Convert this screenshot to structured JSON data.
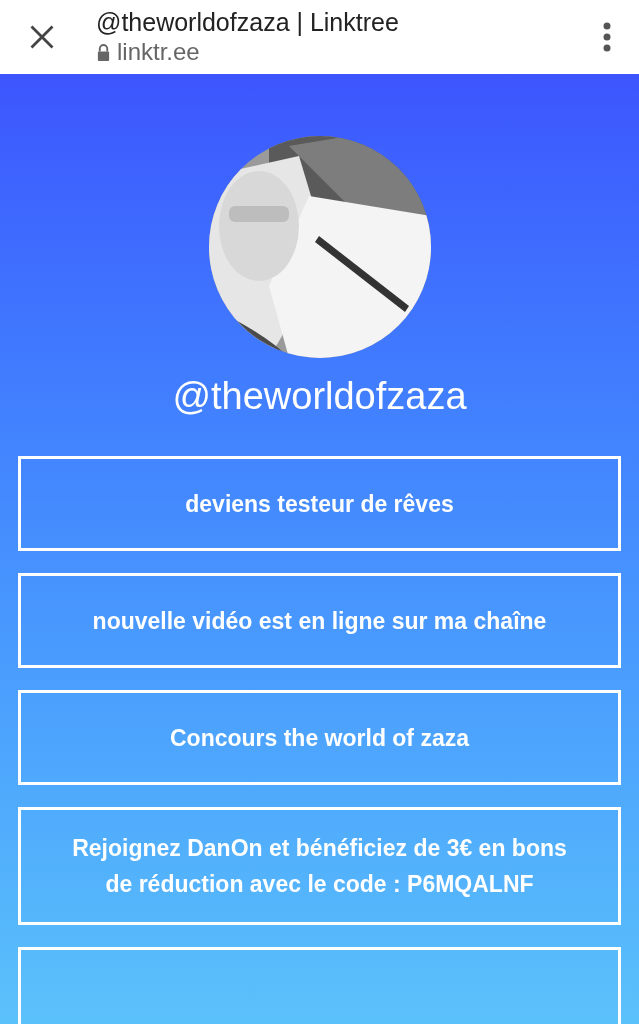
{
  "browser_bar": {
    "title": "@theworldofzaza | Linktree",
    "url": "linktr.ee"
  },
  "profile": {
    "username": "@theworldofzaza"
  },
  "links": [
    {
      "label": "deviens testeur de rêves"
    },
    {
      "label": "nouvelle vidéo est en ligne sur ma chaîne"
    },
    {
      "label": "Concours the world of zaza"
    },
    {
      "label": "Rejoignez DanOn et bénéficiez de 3€ en bons de réduction avec le code : P6MQALNF"
    }
  ]
}
